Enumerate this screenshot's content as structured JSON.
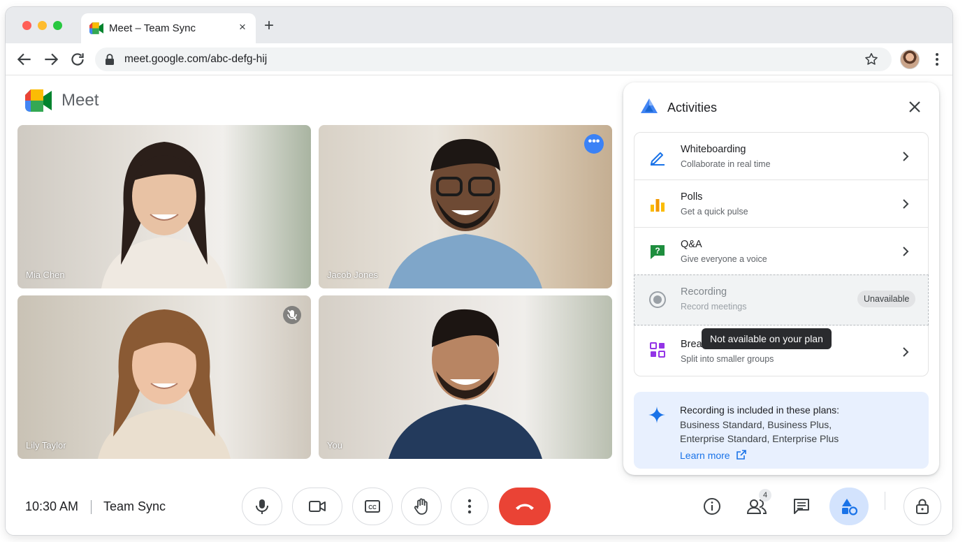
{
  "browser": {
    "tab_title": "Meet – Team Sync",
    "tab_close": "×",
    "new_tab": "+",
    "url": "meet.google.com/abc-defg-hij"
  },
  "app": {
    "name": "Meet"
  },
  "tiles": [
    {
      "name": "Mia Chen"
    },
    {
      "name": "Jacob Jones",
      "more_label": "•••"
    },
    {
      "name": "Lily Taylor"
    },
    {
      "name": "You"
    }
  ],
  "bottom_bar": {
    "time": "10:30 AM",
    "meeting_title": "Team Sync",
    "participant_count": "4"
  },
  "activities": {
    "title": "Activities",
    "items": [
      {
        "title": "Whiteboarding",
        "subtitle": "Collaborate in real time"
      },
      {
        "title": "Polls",
        "subtitle": "Get a quick pulse"
      },
      {
        "title": "Q&A",
        "subtitle": "Give everyone a voice"
      },
      {
        "title": "Recording",
        "subtitle": "Record meetings",
        "badge": "Unavailable"
      },
      {
        "title": "Breakout rooms",
        "subtitle": "Split into smaller groups"
      }
    ],
    "tooltip": "Not available on your plan",
    "info": {
      "title": "Recording is included in these plans:",
      "plans": "Business Standard, Business Plus, Enterprise Standard, Enterprise Plus",
      "link": "Learn more"
    }
  },
  "colors": {
    "accent": "#1a73e8",
    "end_call": "#ea4335",
    "active_button": "#d3e3fd",
    "info_card": "#e8f0fe"
  }
}
